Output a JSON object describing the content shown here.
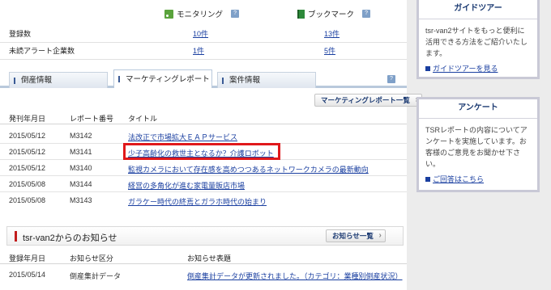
{
  "monitoring": {
    "monitoring_label": "モニタリング",
    "bookmark_label": "ブックマーク",
    "help": "?"
  },
  "summary": {
    "rows": [
      {
        "label": "登録数",
        "monitoring": "10件",
        "bookmark": "13件"
      },
      {
        "label": "未読アラート企業数",
        "monitoring": "1件",
        "bookmark": "5件"
      }
    ]
  },
  "tabs": [
    "倒産情報",
    "マーケティングレポート",
    "案件情報"
  ],
  "report": {
    "list_button": "マーケティングレポート一覧",
    "headers": {
      "date": "発刊年月日",
      "number": "レポート番号",
      "title": "タイトル"
    },
    "rows": [
      {
        "date": "2015/05/12",
        "number": "M3142",
        "title": "法改正で市場拡大ＥＡＰサービス"
      },
      {
        "date": "2015/05/12",
        "number": "M3141",
        "title": "少子高齢化の救世主となるか？介護ロボット"
      },
      {
        "date": "2015/05/12",
        "number": "M3140",
        "title": "監視カメラにおいて存在感を高めつつあるネットワークカメラの最新動向"
      },
      {
        "date": "2015/05/08",
        "number": "M3144",
        "title": "経営の多角化が進む家電量販店市場"
      },
      {
        "date": "2015/05/08",
        "number": "M3143",
        "title": "ガラケー時代の終焉とガラホ時代の始まり"
      }
    ]
  },
  "news": {
    "title": "tsr-van2からのお知らせ",
    "list_button": "お知らせ一覧",
    "headers": {
      "date": "登録年月日",
      "category": "お知らせ区分",
      "subject": "お知らせ表題"
    },
    "rows": [
      {
        "date": "2015/05/14",
        "category": "倒産集計データ",
        "subject": "倒産集計データが更新されました。（カテゴリ：業種別倒産状況）"
      }
    ]
  },
  "sidebar": {
    "guide": {
      "title": "ガイドツアー",
      "body": "tsr-van2サイトをもっと便利に活用できる方法をご紹介いたします。",
      "link": "ガイドツアーを見る"
    },
    "survey": {
      "title": "アンケート",
      "body": "TSRレポートの内容についてアンケートを実施しています。お客様のご意見をお聞かせ下さい。",
      "link": "ご回答はこちら"
    }
  }
}
